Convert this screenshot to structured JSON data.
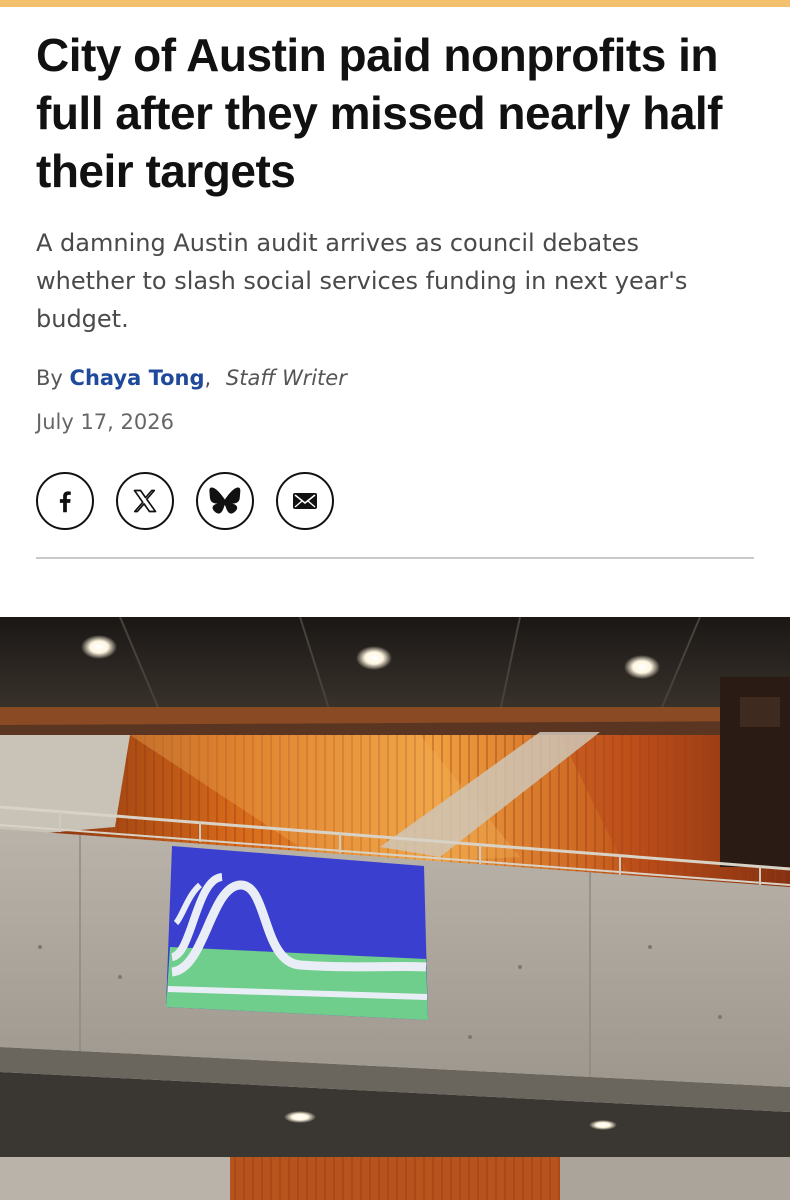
{
  "article": {
    "headline": "City of Austin paid nonprofits in full after they missed nearly half their targets",
    "dek": "A damning Austin audit arrives as council debates whether to slash social services funding in next year's budget.",
    "byline_prefix": "By",
    "author": "Chaya Tong",
    "byline_separator": ",",
    "author_role": "Staff Writer",
    "date": "July 17, 2026"
  },
  "share": {
    "icons": [
      "facebook-icon",
      "x-icon",
      "bluesky-icon",
      "email-icon"
    ]
  },
  "colors": {
    "accent_bar": "#f3c06e",
    "author_link": "#1f4a9c",
    "flag_blue": "#3a3fd0",
    "flag_green": "#6fce8c"
  }
}
